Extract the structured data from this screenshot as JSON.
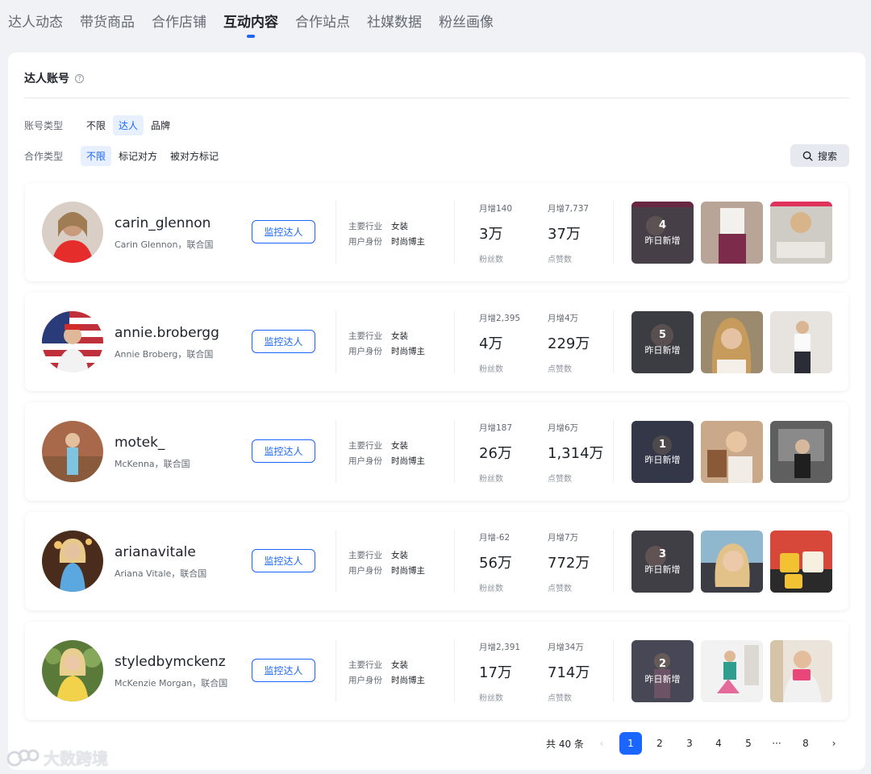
{
  "tabs": [
    "达人动态",
    "带货商品",
    "合作店铺",
    "互动内容",
    "合作站点",
    "社媒数据",
    "粉丝画像"
  ],
  "active_tab": "互动内容",
  "section": {
    "title": "达人账号",
    "help": "?"
  },
  "filters": {
    "account_type": {
      "label": "账号类型",
      "options": [
        "不限",
        "达人",
        "品牌"
      ],
      "selected": "达人"
    },
    "coop_type": {
      "label": "合作类型",
      "options": [
        "不限",
        "标记对方",
        "被对方标记"
      ],
      "selected": "不限"
    }
  },
  "search_button": "搜索",
  "labels": {
    "monitor": "监控达人",
    "industry_key": "主要行业",
    "identity_key": "用户身份",
    "followers": "粉丝数",
    "likes": "点赞数",
    "new_yesterday": "昨日新增"
  },
  "creators": [
    {
      "handle": "carin_glennon",
      "subtitle": "Carin Glennon，联合国",
      "industry": "女装",
      "identity": "时尚博主",
      "fans_inc": "月增140",
      "fans": "3万",
      "likes_inc": "月增7,737",
      "likes": "37万",
      "new_count": "4"
    },
    {
      "handle": "annie.brobergg",
      "subtitle": "Annie Broberg，联合国",
      "industry": "女装",
      "identity": "时尚博主",
      "fans_inc": "月增2,395",
      "fans": "4万",
      "likes_inc": "月增4万",
      "likes": "229万",
      "new_count": "5"
    },
    {
      "handle": "motek_",
      "subtitle": "McKenna，联合国",
      "industry": "女装",
      "identity": "时尚博主",
      "fans_inc": "月增187",
      "fans": "26万",
      "likes_inc": "月增6万",
      "likes": "1,314万",
      "new_count": "1"
    },
    {
      "handle": "arianavitale",
      "subtitle": "Ariana Vitale，联合国",
      "industry": "女装",
      "identity": "时尚博主",
      "fans_inc": "月增-62",
      "fans": "56万",
      "likes_inc": "月增7万",
      "likes": "772万",
      "new_count": "3"
    },
    {
      "handle": "styledbymckenz",
      "subtitle": "McKenzie Morgan，联合国",
      "industry": "女装",
      "identity": "时尚博主",
      "fans_inc": "月增2,391",
      "fans": "17万",
      "likes_inc": "月增34万",
      "likes": "714万",
      "new_count": "2"
    }
  ],
  "pagination": {
    "total": "共 40 条",
    "pages": [
      "1",
      "2",
      "3",
      "4",
      "5",
      "···",
      "8"
    ],
    "current": "1",
    "prev": "‹",
    "next": "›"
  },
  "watermark": "大数跨境",
  "colors": {
    "accent": "#1a66ff",
    "page_bg": "#f1f2f6"
  }
}
